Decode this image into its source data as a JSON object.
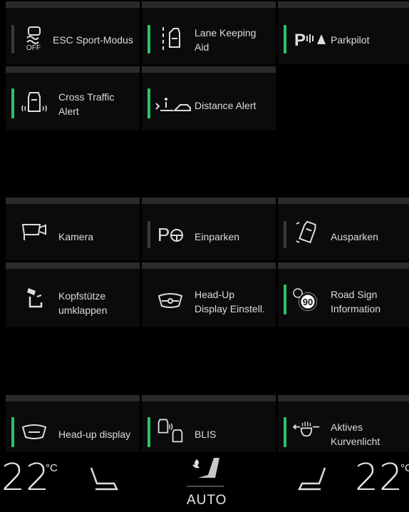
{
  "tiles": {
    "esc": {
      "label_1": "ESC Sport-Modus",
      "label_2": "",
      "icon": "esc-off-icon",
      "indicator": "off"
    },
    "lane": {
      "label_1": "Lane Keeping",
      "label_2": "Aid",
      "icon": "lane-keeping-icon",
      "indicator": "on"
    },
    "park": {
      "label_1": "Parkpilot",
      "label_2": "",
      "icon": "park-pilot-icon",
      "indicator": "on"
    },
    "cross": {
      "label_1": "Cross Traffic",
      "label_2": "Alert",
      "icon": "cross-traffic-icon",
      "indicator": "on"
    },
    "distance": {
      "label_1": "Distance Alert",
      "label_2": "",
      "icon": "distance-alert-icon",
      "indicator": "on"
    },
    "kamera": {
      "label_1": "Kamera",
      "label_2": "",
      "icon": "camera-icon",
      "indicator": "none"
    },
    "einparken": {
      "label_1": "Einparken",
      "label_2": "",
      "icon": "park-assist-in-icon",
      "indicator": "off"
    },
    "ausparken": {
      "label_1": "Ausparken",
      "label_2": "",
      "icon": "park-assist-out-icon",
      "indicator": "off"
    },
    "kopf": {
      "label_1": "Kopfstütze",
      "label_2": "umklappen",
      "icon": "headrest-fold-icon",
      "indicator": "none"
    },
    "hud_settings": {
      "label_1": "Head-Up",
      "label_2": "Display Einstell.",
      "icon": "hud-settings-icon",
      "indicator": "none"
    },
    "road_sign": {
      "label_1": "Road Sign",
      "label_2": "Information",
      "icon": "road-sign-icon",
      "indicator": "on",
      "sign_value": "90"
    },
    "hud": {
      "label_1": "Head-up display",
      "label_2": "",
      "icon": "head-up-display-icon",
      "indicator": "on"
    },
    "blis": {
      "label_1": "BLIS",
      "label_2": "",
      "icon": "blis-icon",
      "indicator": "on"
    },
    "kurvenlicht": {
      "label_1": "Aktives",
      "label_2": "Kurvenlicht",
      "icon": "cornering-light-icon",
      "indicator": "on"
    }
  },
  "climate": {
    "left_temp": "22",
    "right_temp": "22",
    "unit": "°C",
    "fan_mode": "AUTO",
    "accent": "#29c36a"
  }
}
